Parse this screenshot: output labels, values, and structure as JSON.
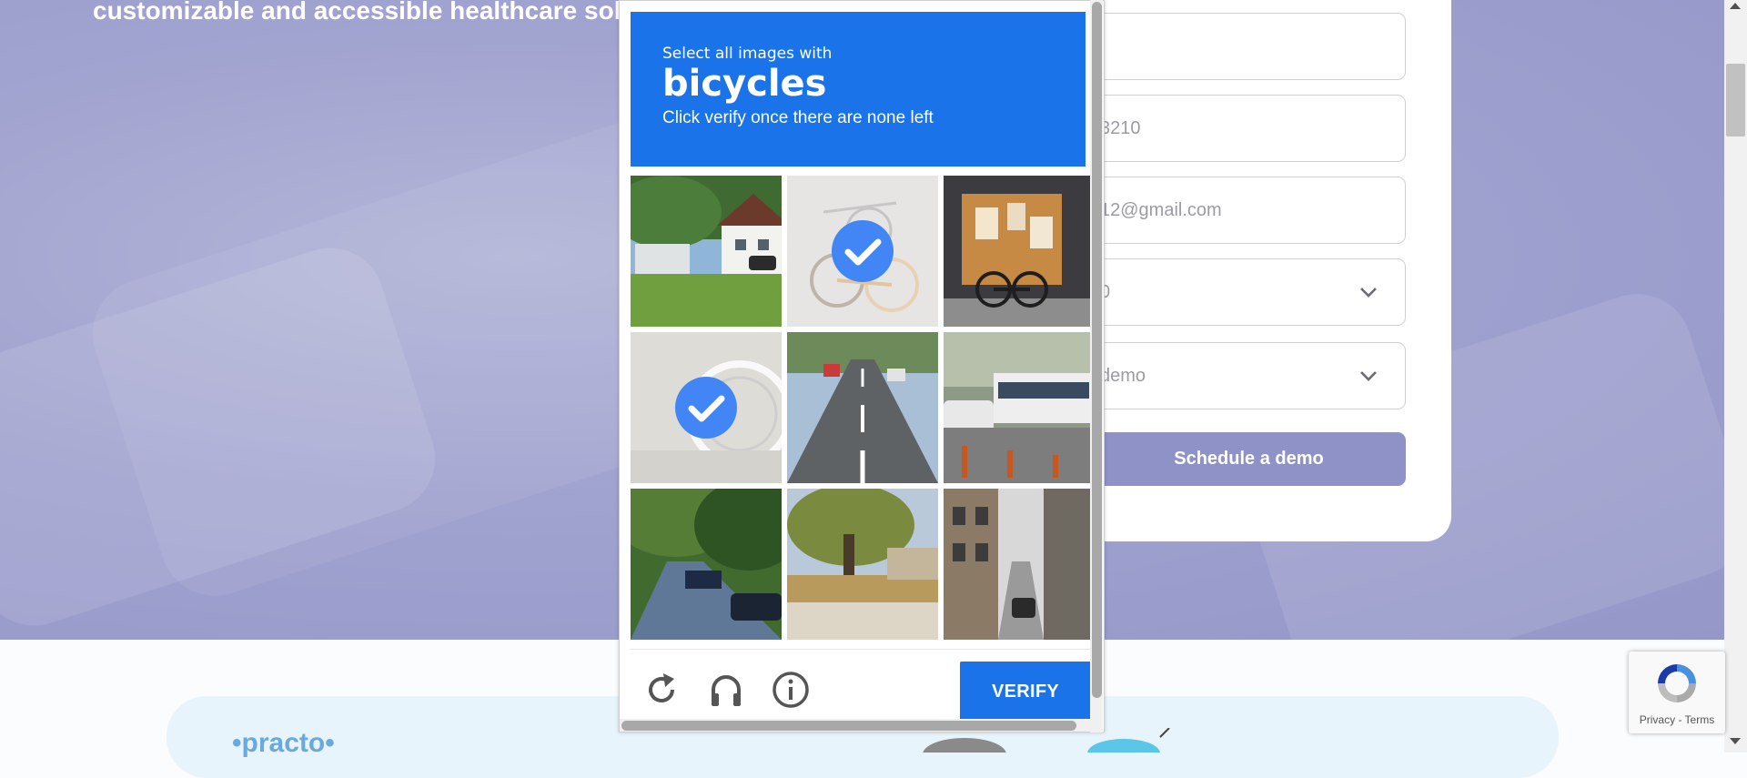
{
  "hero": {
    "headline": "customizable and accessible healthcare solu"
  },
  "form": {
    "fields": [
      {
        "value": ""
      },
      {
        "value": "3210"
      },
      {
        "value": "12@gmail.com"
      },
      {
        "value": "0"
      },
      {
        "value": "demo"
      }
    ],
    "schedule_label": "Schedule a demo"
  },
  "partner": {
    "logo_text": "•practo•"
  },
  "recaptcha_badge": {
    "links": "Privacy - Terms"
  },
  "captcha": {
    "instruction_small": "Select all images with",
    "target_object": "bicycles",
    "instruction_sub": "Click verify once there are none left",
    "verify_label": "VERIFY",
    "tiles": [
      {
        "selected": false,
        "theme": "village-house"
      },
      {
        "selected": true,
        "theme": "bicycles"
      },
      {
        "selected": false,
        "theme": "shopfront-bicycle"
      },
      {
        "selected": true,
        "theme": "bicycle-wheel"
      },
      {
        "selected": false,
        "theme": "highway"
      },
      {
        "selected": false,
        "theme": "city-bus"
      },
      {
        "selected": false,
        "theme": "tree-lined-street"
      },
      {
        "selected": false,
        "theme": "park-tree"
      },
      {
        "selected": false,
        "theme": "narrow-street"
      }
    ],
    "icons": [
      "reload-icon",
      "audio-icon",
      "info-icon"
    ],
    "colors": {
      "accent": "#1a73e8",
      "selected_check": "#4285f4"
    }
  }
}
